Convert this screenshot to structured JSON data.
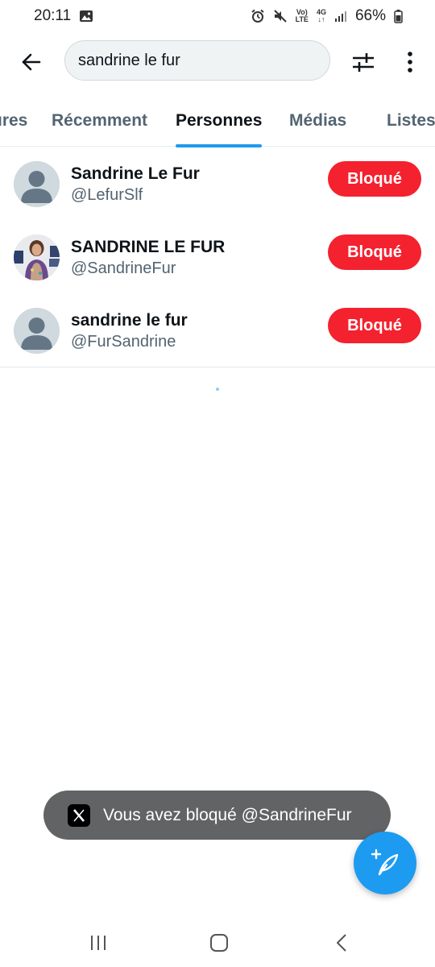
{
  "status_bar": {
    "time": "20:11",
    "battery_percent": "66%",
    "network_label_top": "Vo)",
    "network_label_bottom": "LTE",
    "network_gen": "4G",
    "icons": [
      "image-icon",
      "alarm-icon",
      "mute-icon",
      "volte-icon",
      "4g-data-icon",
      "signal-icon",
      "battery-icon"
    ]
  },
  "search": {
    "value": "sandrine le fur"
  },
  "tabs": [
    {
      "label": "ures",
      "active": false
    },
    {
      "label": "Récemment",
      "active": false
    },
    {
      "label": "Personnes",
      "active": true
    },
    {
      "label": "Médias",
      "active": false
    },
    {
      "label": "Listes",
      "active": false
    }
  ],
  "people": [
    {
      "name": "Sandrine Le Fur",
      "handle": "@LefurSlf",
      "action": "Bloqué",
      "avatar": "default"
    },
    {
      "name": "SANDRINE LE FUR",
      "handle": "@SandrineFur",
      "action": "Bloqué",
      "avatar": "photo"
    },
    {
      "name": "sandrine le fur",
      "handle": "@FurSandrine",
      "action": "Bloqué",
      "avatar": "default"
    }
  ],
  "toast": {
    "message": "Vous avez bloqué @SandrineFur"
  },
  "colors": {
    "accent": "#1d9bf0",
    "blocked": "#f4212e",
    "toast_bg": "#616364"
  }
}
